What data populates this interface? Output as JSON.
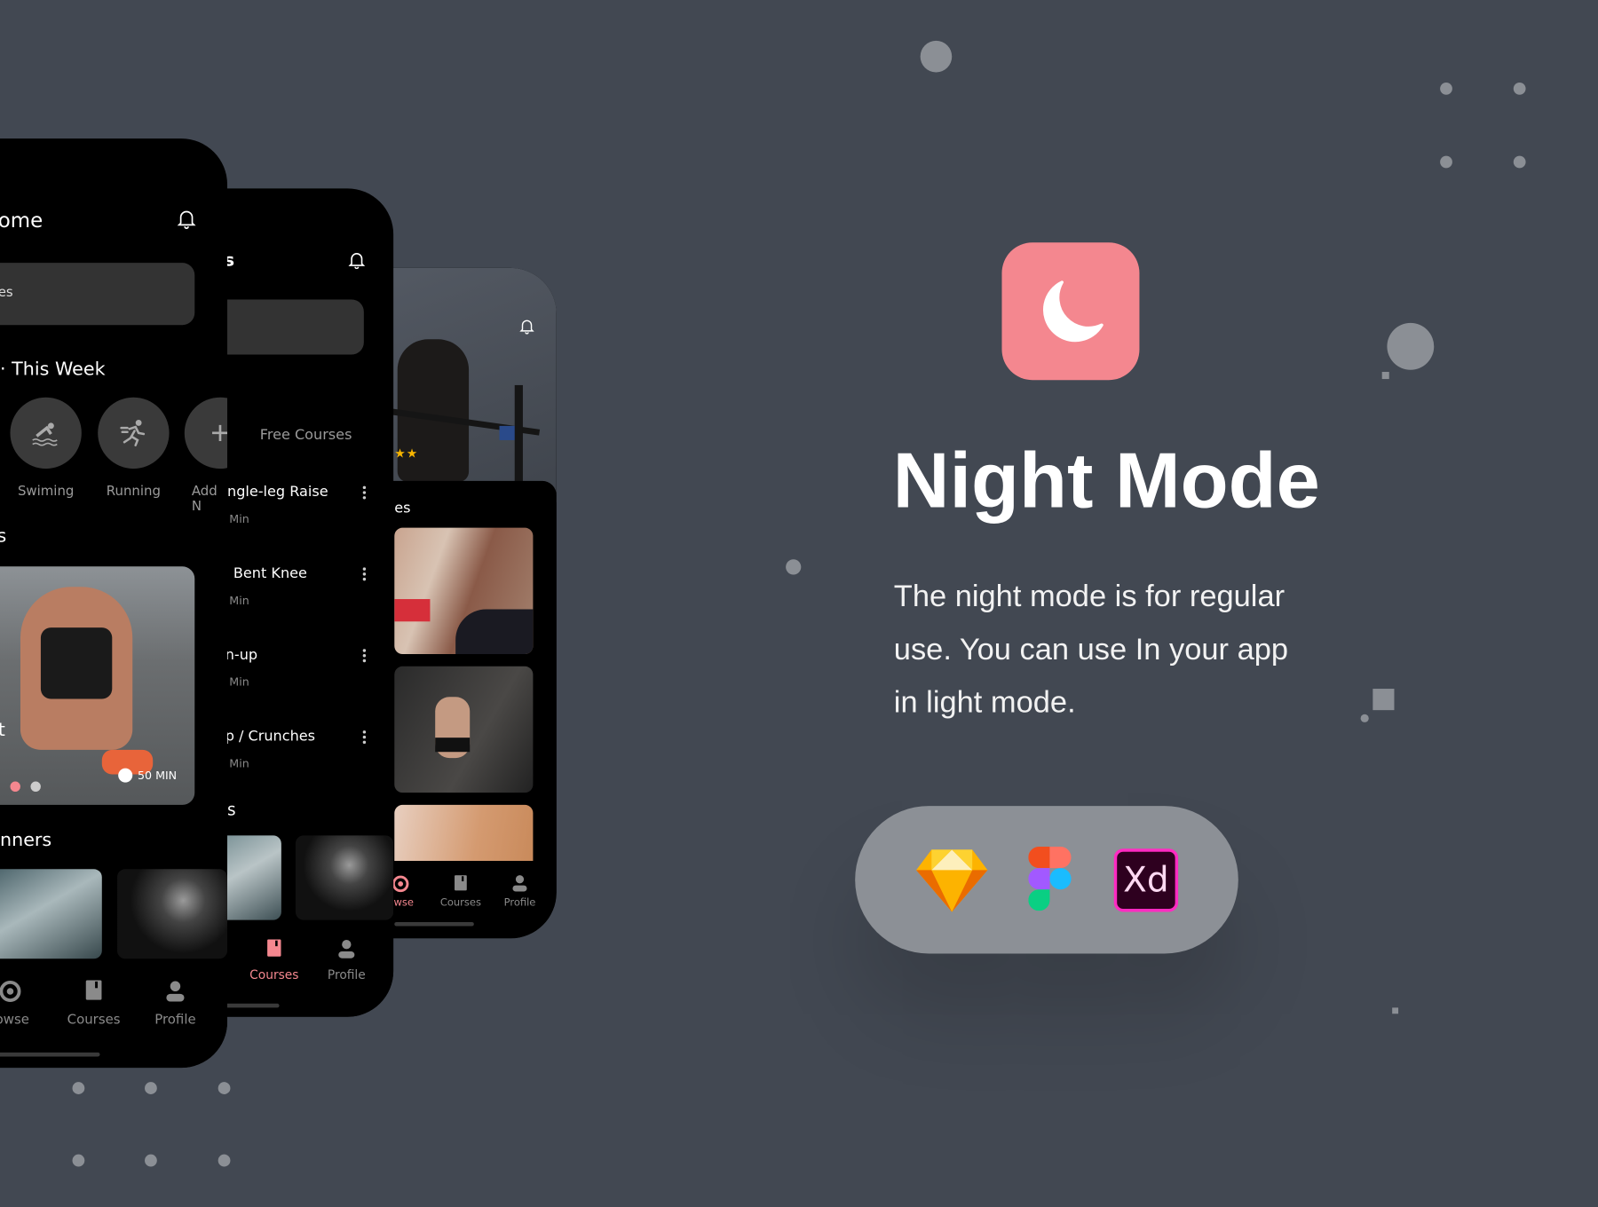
{
  "hero": {
    "title": "Night Mode",
    "description_lines": [
      "The night mode is for regular",
      "use. You can use In your app",
      "in light mode."
    ],
    "icon": "moon-icon",
    "accent_color": "#f4878f"
  },
  "tools": [
    {
      "name": "Sketch",
      "icon": "sketch-icon"
    },
    {
      "name": "Figma",
      "icon": "figma-icon"
    },
    {
      "name": "Adobe XD",
      "icon": "adobe-xd-icon",
      "label": "Xd"
    }
  ],
  "phone_home": {
    "title": "ome",
    "search_text": "es",
    "section_week": "This Week",
    "activities": [
      {
        "label": "Swiming",
        "icon": "swimming-icon"
      },
      {
        "label": "Running",
        "icon": "running-icon"
      },
      {
        "label": "Add N",
        "icon": "plus-icon"
      }
    ],
    "section_featured": "s",
    "card_title": "t",
    "card_duration": "50 MIN",
    "section_beginners": "nners",
    "nav": [
      {
        "label": "owse",
        "icon": "browse-icon"
      },
      {
        "label": "Courses",
        "icon": "book-icon"
      },
      {
        "label": "Profile",
        "icon": "profile-icon"
      }
    ]
  },
  "phone_courses": {
    "title": "s",
    "tab_label": "Free Courses",
    "exercises": [
      {
        "name": "ngle-leg Raise",
        "meta": "Min"
      },
      {
        "name": "Bent Knee",
        "meta": "Min"
      },
      {
        "name": "n-up",
        "meta": "Min"
      },
      {
        "name": "p / Crunches",
        "meta": "Min"
      }
    ],
    "section": "s",
    "nav": [
      {
        "label": "Courses",
        "icon": "book-icon",
        "active": true
      },
      {
        "label": "Profile",
        "icon": "profile-icon"
      }
    ]
  },
  "phone_browse": {
    "section": "es",
    "rating_stars": 2,
    "nav": [
      {
        "label": "owse",
        "icon": "browse-icon",
        "active": true
      },
      {
        "label": "Courses",
        "icon": "book-icon"
      },
      {
        "label": "Profile",
        "icon": "profile-icon"
      }
    ]
  }
}
